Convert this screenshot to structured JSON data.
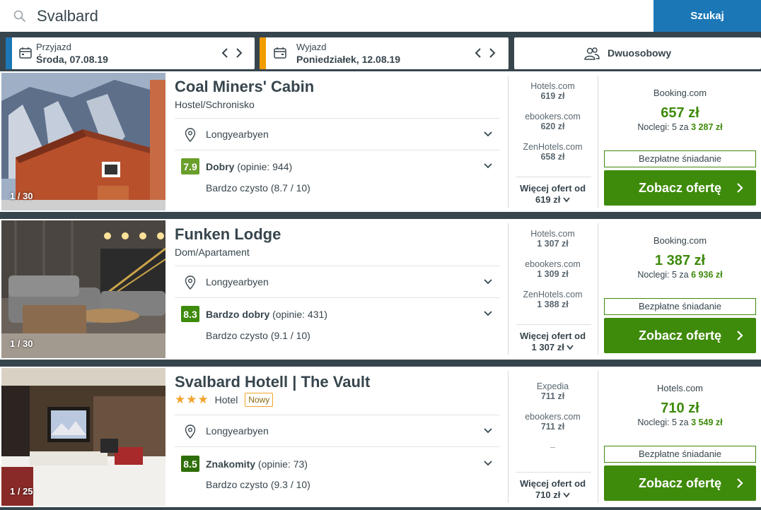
{
  "search": {
    "value": "Svalbard",
    "button_label": "Szukaj"
  },
  "checkin": {
    "label": "Przyjazd",
    "value": "Środa, 07.08.19",
    "accent": "#1c77b7"
  },
  "checkout": {
    "label": "Wyjazd",
    "value": "Poniedziałek, 12.08.19",
    "accent": "#f29c00"
  },
  "guests": {
    "label": "Dwuosobowy"
  },
  "colors": {
    "accent": "#1c77b7",
    "deal_green": "#3e8a0a"
  },
  "hotels": [
    {
      "name": "Coal Miners' Cabin",
      "type": "Hostel/Schronisko",
      "stars": "",
      "badge": "",
      "photo_count": "1 / 30",
      "location": "Longyearbyen",
      "score": "7.9",
      "score_color": "#6a9f2c",
      "rating_label": "Dobry",
      "rating_reviews": "(opinie: 944)",
      "cleanliness": "Bardzo czysto (8.7 / 10)",
      "providers": [
        {
          "name": "Hotels.com",
          "price": "619 zł"
        },
        {
          "name": "ebookers.com",
          "price": "620 zł"
        },
        {
          "name": "ZenHotels.com",
          "price": "658 zł"
        }
      ],
      "more_label": "Więcej ofert od",
      "more_price": "619 zł",
      "best_site": "Booking.com",
      "best_price": "657 zł",
      "nights_text": "Noclegi: 5 za",
      "nights_total": "3 287 zł",
      "breakfast": "Bezpłatne śniadanie",
      "cta_label": "Zobacz ofertę"
    },
    {
      "name": "Funken Lodge",
      "type": "Dom/Apartament",
      "stars": "",
      "badge": "",
      "photo_count": "1 / 30",
      "location": "Longyearbyen",
      "score": "8.3",
      "score_color": "#3e8a0a",
      "rating_label": "Bardzo dobry",
      "rating_reviews": "(opinie: 431)",
      "cleanliness": "Bardzo czysto (9.1 / 10)",
      "providers": [
        {
          "name": "Hotels.com",
          "price": "1 307 zł"
        },
        {
          "name": "ebookers.com",
          "price": "1 309 zł"
        },
        {
          "name": "ZenHotels.com",
          "price": "1 388 zł"
        }
      ],
      "more_label": "Więcej ofert od",
      "more_price": "1 307 zł",
      "best_site": "Booking.com",
      "best_price": "1 387 zł",
      "nights_text": "Noclegi: 5 za",
      "nights_total": "6 936 zł",
      "breakfast": "Bezpłatne śniadanie",
      "cta_label": "Zobacz ofertę"
    },
    {
      "name": "Svalbard Hotell | The Vault",
      "type": "Hotel",
      "stars": "★★★",
      "badge": "Nowy",
      "photo_count": "1 / 25",
      "location": "Longyearbyen",
      "score": "8.5",
      "score_color": "#2e6e08",
      "rating_label": "Znakomity",
      "rating_reviews": "(opinie: 73)",
      "cleanliness": "Bardzo czysto (9.3 / 10)",
      "providers": [
        {
          "name": "Expedia",
          "price": "711 zł"
        },
        {
          "name": "ebookers.com",
          "price": "711 zł"
        },
        {
          "name": "",
          "price": "–"
        }
      ],
      "more_label": "Więcej ofert od",
      "more_price": "710 zł",
      "best_site": "Hotels.com",
      "best_price": "710 zł",
      "nights_text": "Noclegi: 5 za",
      "nights_total": "3 549 zł",
      "breakfast": "Bezpłatne śniadanie",
      "cta_label": "Zobacz ofertę"
    }
  ]
}
